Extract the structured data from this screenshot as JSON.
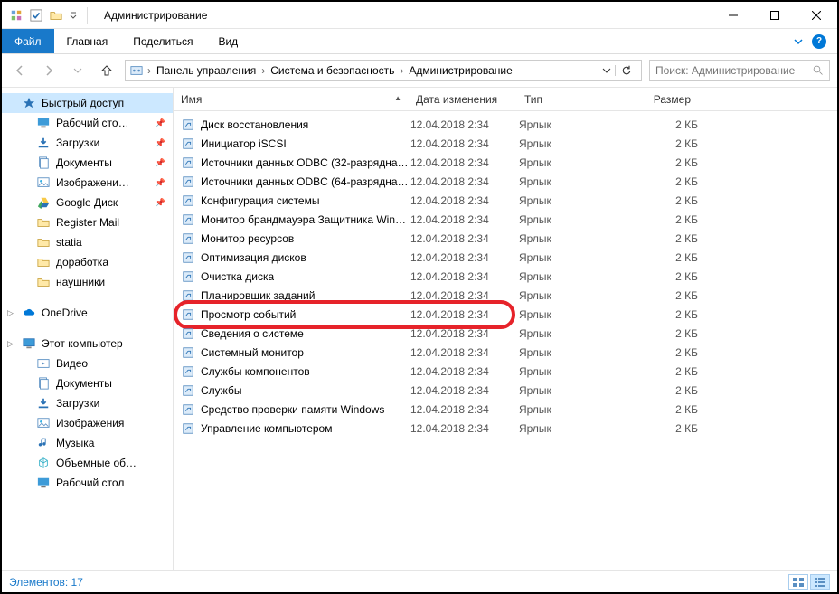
{
  "window": {
    "title": "Администрирование"
  },
  "ribbon": {
    "file": "Файл",
    "tabs": [
      "Главная",
      "Поделиться",
      "Вид"
    ]
  },
  "breadcrumbs": [
    "Панель управления",
    "Система и безопасность",
    "Администрирование"
  ],
  "search": {
    "placeholder": "Поиск: Администрирование"
  },
  "columns": {
    "name": "Имя",
    "date": "Дата изменения",
    "type": "Тип",
    "size": "Размер"
  },
  "nav": {
    "quick_access": "Быстрый доступ",
    "quick_items": [
      {
        "label": "Рабочий сто…",
        "icon": "desktop",
        "pinned": true
      },
      {
        "label": "Загрузки",
        "icon": "downloads",
        "pinned": true
      },
      {
        "label": "Документы",
        "icon": "documents",
        "pinned": true
      },
      {
        "label": "Изображени…",
        "icon": "pictures",
        "pinned": true
      },
      {
        "label": "Google Диск",
        "icon": "gdrive",
        "pinned": true
      },
      {
        "label": "Register Mail",
        "icon": "folder",
        "pinned": false
      },
      {
        "label": "statia",
        "icon": "folder",
        "pinned": false
      },
      {
        "label": "доработка",
        "icon": "folder",
        "pinned": false
      },
      {
        "label": "наушники",
        "icon": "folder",
        "pinned": false
      }
    ],
    "onedrive": "OneDrive",
    "this_pc": "Этот компьютер",
    "pc_items": [
      {
        "label": "Видео",
        "icon": "video"
      },
      {
        "label": "Документы",
        "icon": "documents"
      },
      {
        "label": "Загрузки",
        "icon": "downloads"
      },
      {
        "label": "Изображения",
        "icon": "pictures"
      },
      {
        "label": "Музыка",
        "icon": "music"
      },
      {
        "label": "Объемные об…",
        "icon": "3d"
      },
      {
        "label": "Рабочий стол",
        "icon": "desktop"
      }
    ]
  },
  "files": [
    {
      "name": "Диск восстановления",
      "date": "12.04.2018 2:34",
      "type": "Ярлык",
      "size": "2 КБ"
    },
    {
      "name": "Инициатор iSCSI",
      "date": "12.04.2018 2:34",
      "type": "Ярлык",
      "size": "2 КБ"
    },
    {
      "name": "Источники данных ODBC (32-разрядна…",
      "date": "12.04.2018 2:34",
      "type": "Ярлык",
      "size": "2 КБ"
    },
    {
      "name": "Источники данных ODBC (64-разрядна…",
      "date": "12.04.2018 2:34",
      "type": "Ярлык",
      "size": "2 КБ"
    },
    {
      "name": "Конфигурация системы",
      "date": "12.04.2018 2:34",
      "type": "Ярлык",
      "size": "2 КБ"
    },
    {
      "name": "Монитор брандмауэра Защитника Win…",
      "date": "12.04.2018 2:34",
      "type": "Ярлык",
      "size": "2 КБ"
    },
    {
      "name": "Монитор ресурсов",
      "date": "12.04.2018 2:34",
      "type": "Ярлык",
      "size": "2 КБ"
    },
    {
      "name": "Оптимизация дисков",
      "date": "12.04.2018 2:34",
      "type": "Ярлык",
      "size": "2 КБ"
    },
    {
      "name": "Очистка диска",
      "date": "12.04.2018 2:34",
      "type": "Ярлык",
      "size": "2 КБ"
    },
    {
      "name": "Планировщик заданий",
      "date": "12.04.2018 2:34",
      "type": "Ярлык",
      "size": "2 КБ"
    },
    {
      "name": "Просмотр событий",
      "date": "12.04.2018 2:34",
      "type": "Ярлык",
      "size": "2 КБ",
      "highlighted": true
    },
    {
      "name": "Сведения о системе",
      "date": "12.04.2018 2:34",
      "type": "Ярлык",
      "size": "2 КБ"
    },
    {
      "name": "Системный монитор",
      "date": "12.04.2018 2:34",
      "type": "Ярлык",
      "size": "2 КБ"
    },
    {
      "name": "Службы компонентов",
      "date": "12.04.2018 2:34",
      "type": "Ярлык",
      "size": "2 КБ"
    },
    {
      "name": "Службы",
      "date": "12.04.2018 2:34",
      "type": "Ярлык",
      "size": "2 КБ"
    },
    {
      "name": "Средство проверки памяти Windows",
      "date": "12.04.2018 2:34",
      "type": "Ярлык",
      "size": "2 КБ"
    },
    {
      "name": "Управление компьютером",
      "date": "12.04.2018 2:34",
      "type": "Ярлык",
      "size": "2 КБ"
    }
  ],
  "status": {
    "count_label": "Элементов:",
    "count": "17"
  }
}
